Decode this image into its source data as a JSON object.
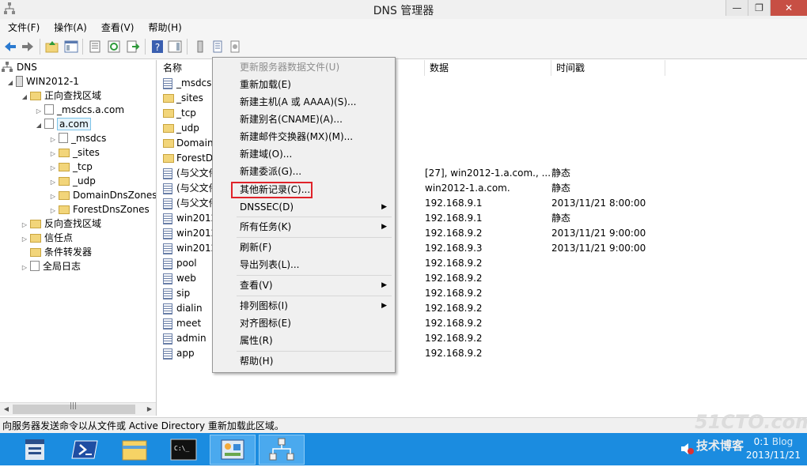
{
  "window": {
    "title": "DNS 管理器",
    "min": "—",
    "max": "❐",
    "close": "✕"
  },
  "menubar": [
    "文件(F)",
    "操作(A)",
    "查看(V)",
    "帮助(H)"
  ],
  "tree": {
    "nodes": [
      {
        "label": "DNS"
      },
      {
        "label": "WIN2012-1"
      },
      {
        "label": "正向查找区域"
      },
      {
        "label": "_msdcs.a.com"
      },
      {
        "label": "a.com"
      },
      {
        "label": "_msdcs"
      },
      {
        "label": "_sites"
      },
      {
        "label": "_tcp"
      },
      {
        "label": "_udp"
      },
      {
        "label": "DomainDnsZones"
      },
      {
        "label": "ForestDnsZones"
      },
      {
        "label": "反向查找区域"
      },
      {
        "label": "信任点"
      },
      {
        "label": "条件转发器"
      },
      {
        "label": "全局日志"
      }
    ],
    "scroll_thumb": "|||"
  },
  "list": {
    "columns": [
      "名称",
      "数据",
      "时间戳"
    ],
    "rows": [
      {
        "name": "_msdcs",
        "data": "",
        "ts": ""
      },
      {
        "name": "_sites",
        "data": "",
        "ts": ""
      },
      {
        "name": "_tcp",
        "data": "",
        "ts": ""
      },
      {
        "name": "_udp",
        "data": "",
        "ts": ""
      },
      {
        "name": "Domain",
        "data": "",
        "ts": ""
      },
      {
        "name": "ForestD",
        "data": "",
        "ts": ""
      },
      {
        "name": "(与父文件",
        "data": "[27], win2012-1.a.com., ...",
        "ts": "静态"
      },
      {
        "name": "(与父文件",
        "data": "win2012-1.a.com.",
        "ts": "静态"
      },
      {
        "name": "(与父文件",
        "data": "192.168.9.1",
        "ts": "2013/11/21 8:00:00"
      },
      {
        "name": "win2012",
        "data": "192.168.9.1",
        "ts": "静态"
      },
      {
        "name": "win2012",
        "data": "192.168.9.2",
        "ts": "2013/11/21 9:00:00"
      },
      {
        "name": "win2012",
        "data": "192.168.9.3",
        "ts": "2013/11/21 9:00:00"
      },
      {
        "name": "pool",
        "data": "192.168.9.2",
        "ts": ""
      },
      {
        "name": "web",
        "data": "192.168.9.2",
        "ts": ""
      },
      {
        "name": "sip",
        "data": "192.168.9.2",
        "ts": ""
      },
      {
        "name": "dialin",
        "data": "192.168.9.2",
        "ts": ""
      },
      {
        "name": "meet",
        "data": "192.168.9.2",
        "ts": ""
      },
      {
        "name": "admin",
        "data": "192.168.9.2",
        "ts": ""
      },
      {
        "name": "app",
        "data": "192.168.9.2",
        "ts": ""
      }
    ]
  },
  "context_menu": {
    "items": [
      {
        "label": "更新服务器数据文件(U)"
      },
      {
        "label": "重新加载(E)"
      },
      {
        "label": "新建主机(A 或 AAAA)(S)..."
      },
      {
        "label": "新建别名(CNAME)(A)..."
      },
      {
        "label": "新建邮件交换器(MX)(M)..."
      },
      {
        "label": "新建域(O)..."
      },
      {
        "label": "新建委派(G)..."
      },
      {
        "label": "其他新记录(C)..."
      },
      {
        "label": "DNSSEC(D)"
      },
      {
        "label": "所有任务(K)"
      },
      {
        "label": "刷新(F)"
      },
      {
        "label": "导出列表(L)..."
      },
      {
        "label": "查看(V)"
      },
      {
        "label": "排列图标(I)"
      },
      {
        "label": "对齐图标(E)"
      },
      {
        "label": "属性(R)"
      },
      {
        "label": "帮助(H)"
      }
    ],
    "submenu_arrow": "▶"
  },
  "status": {
    "text": "向服务器发送命令以从文件或 Active Directory 重新加载此区域。"
  },
  "taskbar": {
    "tray_time": "0:1",
    "tray_date": "2013/11/21",
    "watermark": "51CTO.com",
    "watermark_sub": "技术博客",
    "watermark_blog": "Blog"
  },
  "colors": {
    "taskbar": "#1b8ce0",
    "highlight_box": "#e0232a",
    "menu_bg": "#f0f0f0"
  }
}
